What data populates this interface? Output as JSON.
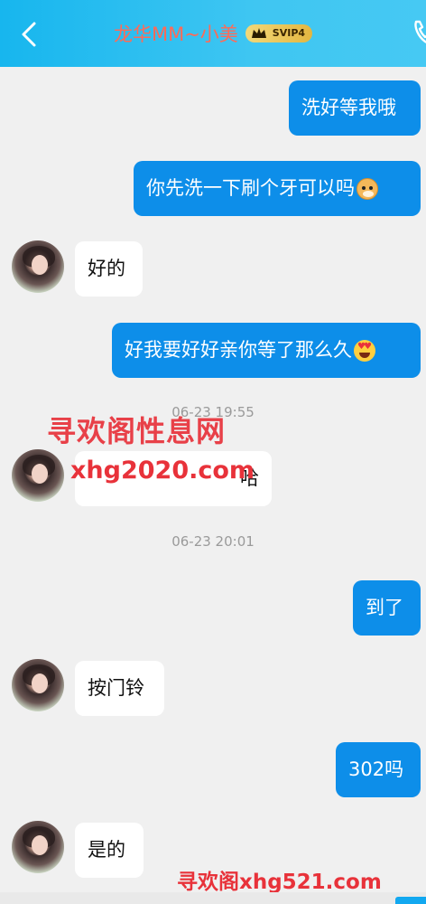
{
  "header": {
    "title": "龙华MM~小美",
    "vip_badge": "SVIP4",
    "back_icon": "back-chevron-icon",
    "call_icon": "phone-icon"
  },
  "messages": [
    {
      "direction": "outgoing",
      "text": "洗好等我哦"
    },
    {
      "direction": "outgoing",
      "text": "你先洗一下刷个牙可以吗",
      "emoji": "hamster-emoji-icon"
    },
    {
      "direction": "incoming",
      "text": "好的"
    },
    {
      "direction": "outgoing",
      "text": "好我要好好亲你等了那么久",
      "emoji": "heart-eyes-emoji-icon"
    },
    {
      "type": "timestamp",
      "text": "06-23 19:55"
    },
    {
      "direction": "incoming",
      "text": "哈"
    },
    {
      "type": "timestamp",
      "text": "06-23 20:01"
    },
    {
      "direction": "outgoing",
      "text": "到了"
    },
    {
      "direction": "incoming",
      "text": "按门铃"
    },
    {
      "direction": "outgoing",
      "text": "302吗"
    },
    {
      "direction": "incoming",
      "text": "是的"
    }
  ],
  "watermarks": {
    "line1": "寻欢阁性息网",
    "line2": "xhg2020.com",
    "line3": "寻欢阁xhg521.com"
  },
  "colors": {
    "header": "#2bbdf0",
    "outgoing_bubble": "#0d8ee9",
    "incoming_bubble": "#ffffff",
    "title": "#ff6a57",
    "watermark": "#e8323a"
  }
}
